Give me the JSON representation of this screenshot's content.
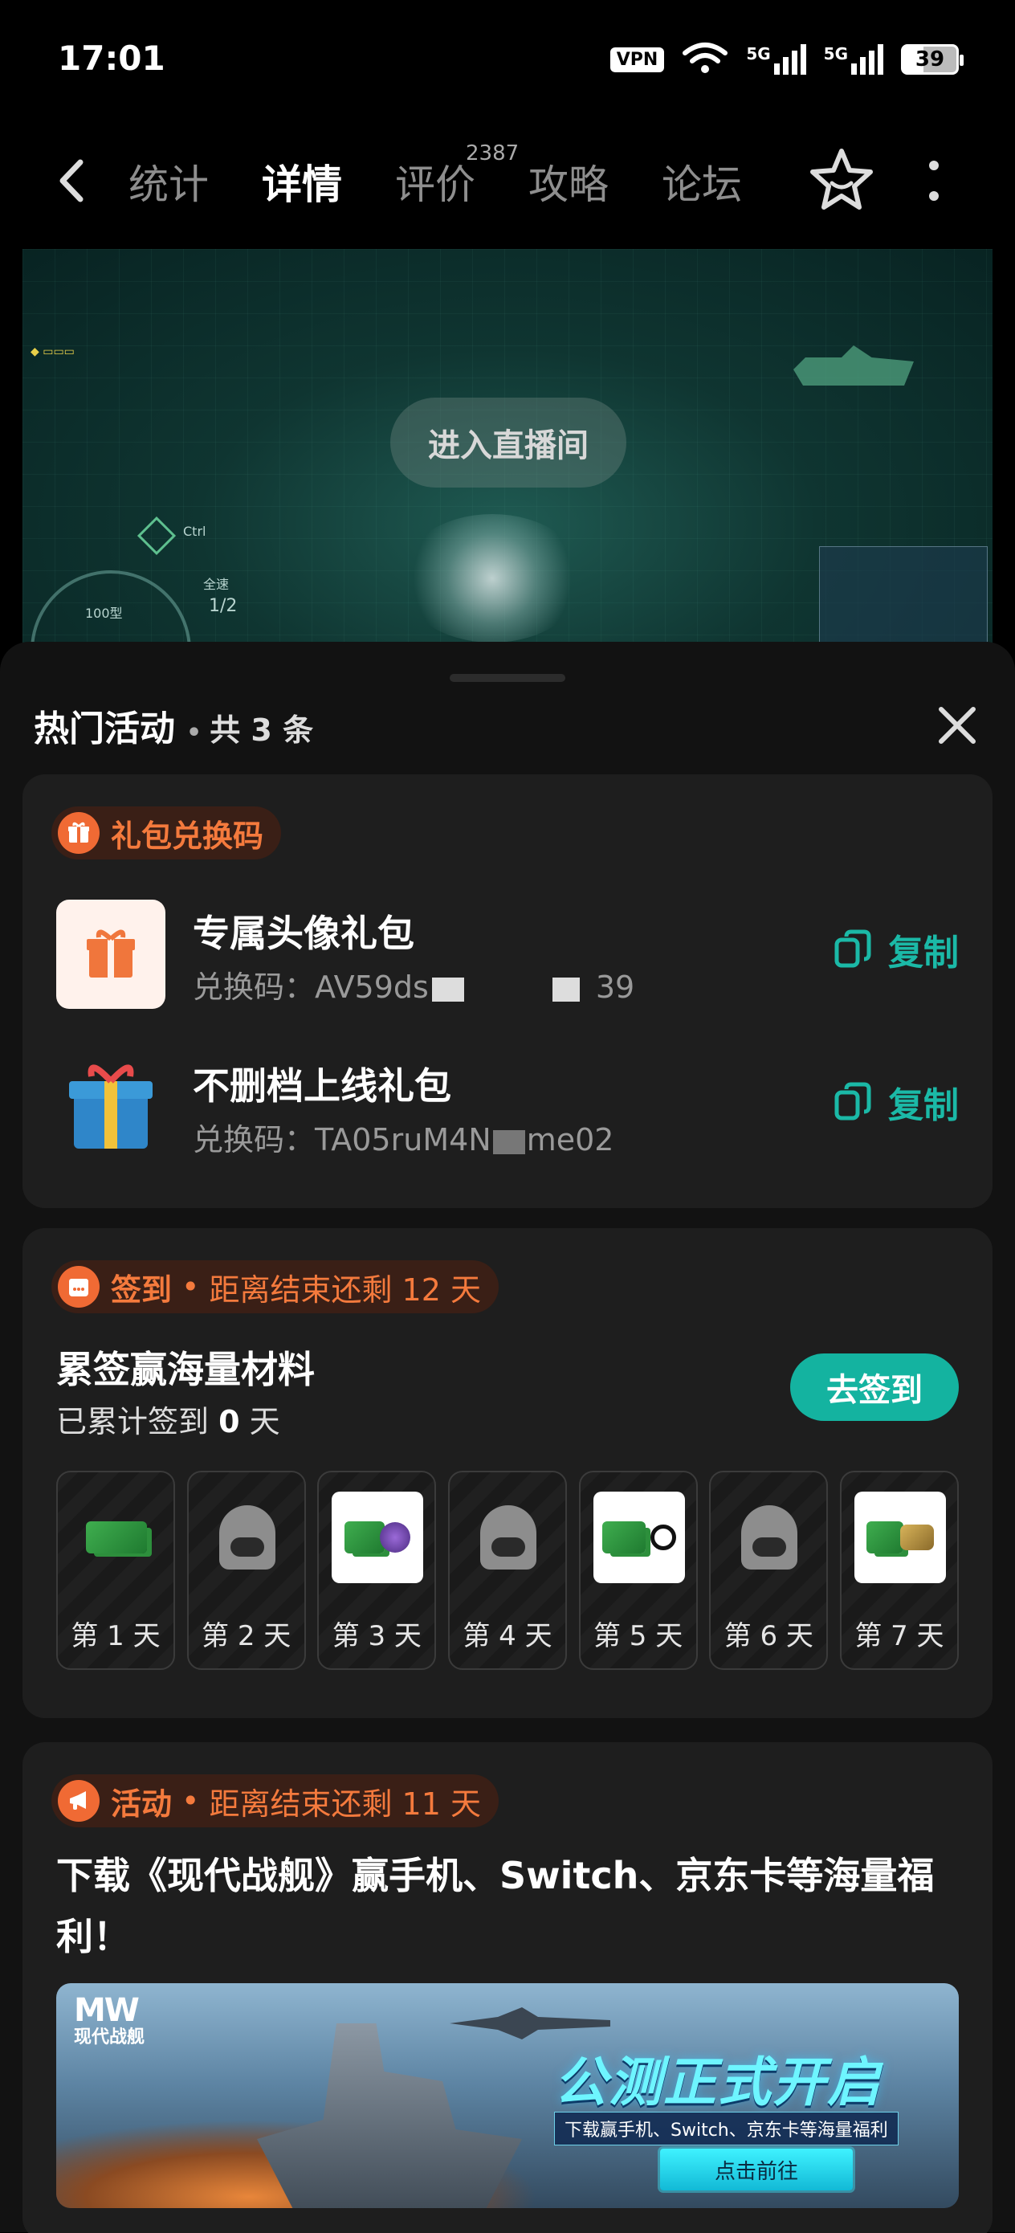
{
  "status_bar": {
    "time": "17:01",
    "vpn": "VPN",
    "network1": "5G",
    "network2": "5G",
    "battery": "39"
  },
  "nav": {
    "tabs": [
      {
        "label": "统计",
        "active": false
      },
      {
        "label": "详情",
        "active": true
      },
      {
        "label": "评价",
        "active": false
      },
      {
        "label": "攻略",
        "active": false
      },
      {
        "label": "论坛",
        "active": false
      }
    ],
    "review_count": "2387",
    "accent_color": "#13a597"
  },
  "video": {
    "live_button": "进入直播间",
    "hud_speed": "100型",
    "hud_fraction": "1/2",
    "hud_full": "全速",
    "hud_ctrl": "Ctrl"
  },
  "sheet": {
    "title": "热门活动",
    "count": "共 3 条",
    "gift_card": {
      "tag": "礼包兑换码",
      "items": [
        {
          "name": "专属头像礼包",
          "code_prefix": "兑换码：AV59ds",
          "code_suffix": "39",
          "copy": "复制"
        },
        {
          "name": "不删档上线礼包",
          "code_prefix": "兑换码：TA05ruM4N",
          "code_suffix": "me02",
          "copy": "复制"
        }
      ]
    },
    "signin_card": {
      "tag": "签到",
      "remaining": "距离结束还剩 12 天",
      "title": "累签赢海量材料",
      "progress_prefix": "已累计签到 ",
      "progress_value": "0",
      "progress_suffix": " 天",
      "button": "去签到",
      "days": [
        {
          "label": "第 1 天",
          "reward": "green-bundle"
        },
        {
          "label": "第 2 天",
          "reward": "locked-ghost"
        },
        {
          "label": "第 3 天",
          "reward": "green-purple-bundle"
        },
        {
          "label": "第 4 天",
          "reward": "locked-ghost"
        },
        {
          "label": "第 5 天",
          "reward": "green-bundle-target"
        },
        {
          "label": "第 6 天",
          "reward": "locked-ghost"
        },
        {
          "label": "第 7 天",
          "reward": "gold-bundle"
        }
      ]
    },
    "promo_card": {
      "tag": "活动",
      "remaining": "距离结束还剩 11 天",
      "title": "下载《现代战舰》赢手机、Switch、京东卡等海量福利！",
      "banner": {
        "logo_mark": "MW",
        "logo_text": "现代战舰",
        "headline": "公测正式开启",
        "tagline": "下载赢手机、Switch、京东卡等海量福利",
        "cta": "点击前往"
      }
    }
  }
}
